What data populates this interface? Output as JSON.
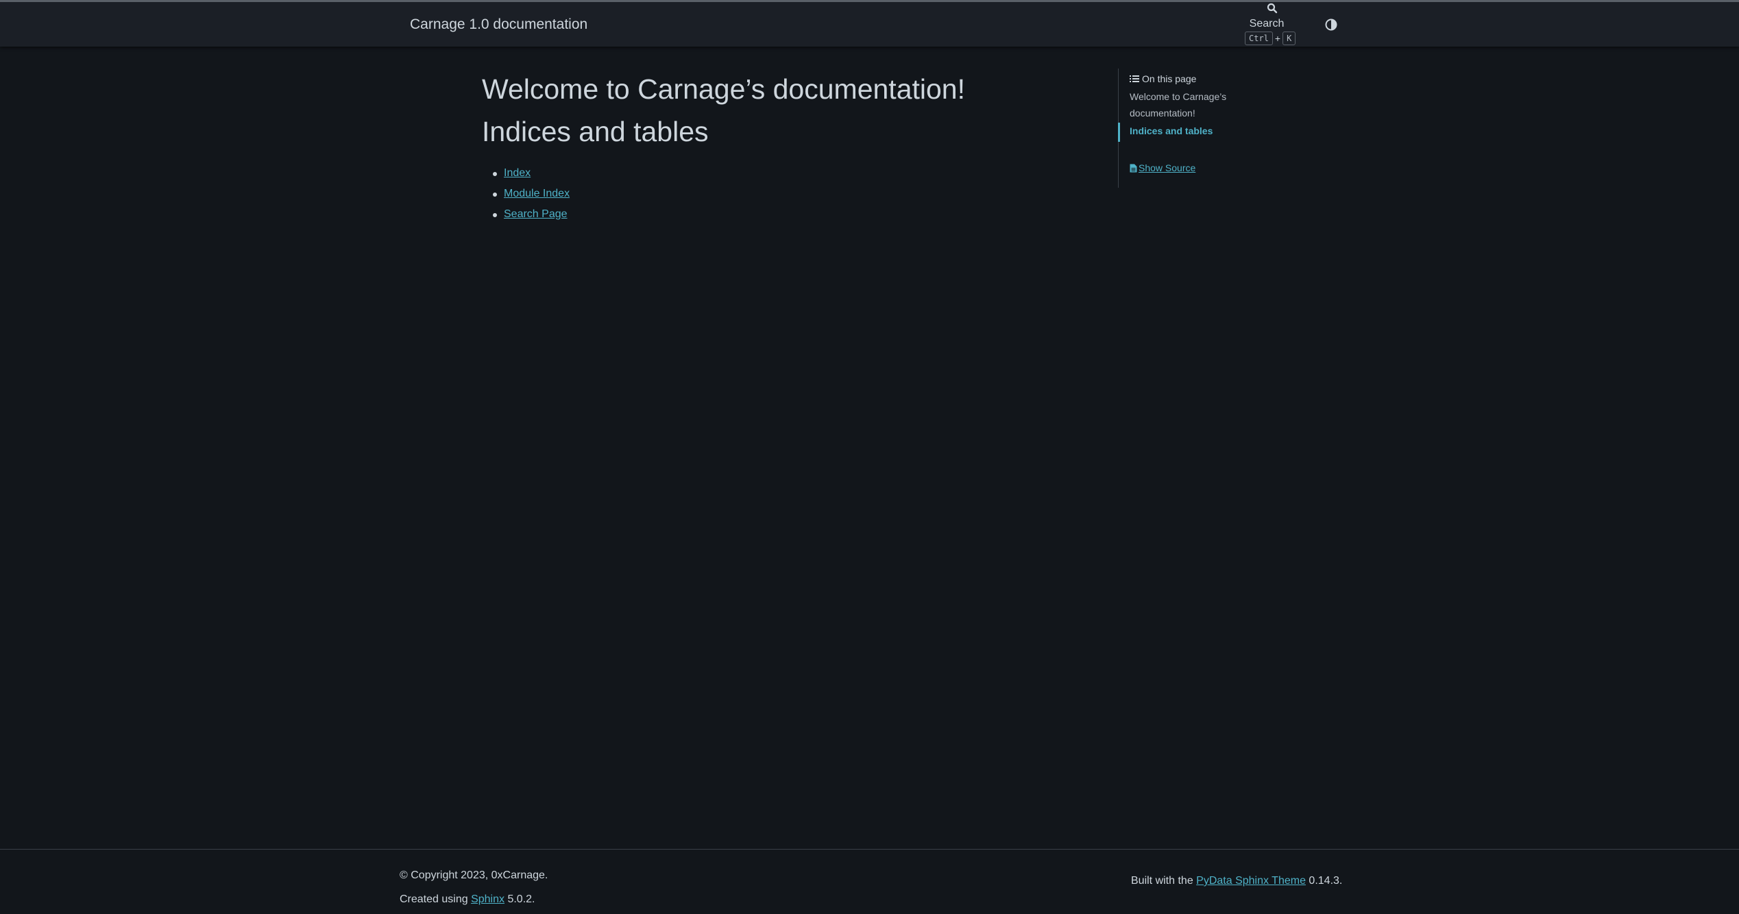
{
  "header": {
    "brand": "Carnage 1.0 documentation",
    "search_label": "Search",
    "shortcut_key1": "Ctrl",
    "shortcut_plus": "+",
    "shortcut_key2": "K"
  },
  "main": {
    "title": "Welcome to Carnage’s documentation!",
    "section_title": "Indices and tables",
    "links": [
      {
        "label": "Index"
      },
      {
        "label": "Module Index"
      },
      {
        "label": "Search Page"
      }
    ]
  },
  "toc": {
    "header": "On this page",
    "items": [
      {
        "label": "Welcome to Carnage’s documentation!"
      },
      {
        "label": "Indices and tables"
      }
    ],
    "show_source": "Show Source"
  },
  "footer": {
    "copyright": "© Copyright 2023, 0xCarnage.",
    "created_prefix": "Created using",
    "sphinx_link": "Sphinx",
    "sphinx_version": "5.0.2.",
    "built_prefix": "Built with the",
    "theme_link": "PyData Sphinx Theme",
    "theme_version": "0.14.3."
  },
  "colors": {
    "background": "#12161b",
    "header_bg": "#1b1f26",
    "accent": "#4fb2c8",
    "text": "#ced6dd"
  },
  "icons": {
    "search": "magnifier-icon",
    "theme": "half-circle-contrast-icon",
    "toc": "list-icon",
    "source": "file-icon"
  }
}
